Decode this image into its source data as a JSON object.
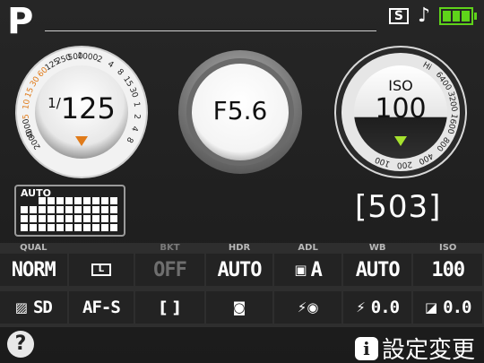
{
  "header": {
    "mode": "P",
    "sound_badge": "S",
    "note_icon": "♪"
  },
  "dials": {
    "shutter": {
      "value": "1/125",
      "top_value": "125",
      "scale": [
        "2000",
        "4000",
        "5",
        "10",
        "15",
        "30",
        "60",
        "125",
        "250",
        "500",
        "1000",
        "2",
        "4",
        "8",
        "15",
        "30",
        "1",
        "2",
        "4",
        "8"
      ]
    },
    "aperture": {
      "value": "F5.6"
    },
    "iso": {
      "label": "ISO",
      "value": "100",
      "scale": [
        "Hi",
        "6400",
        "3200",
        "1600",
        "800",
        "400",
        "200",
        "100"
      ]
    }
  },
  "drive": {
    "auto_label": "AUTO"
  },
  "shots_remaining": "[503]",
  "info_row1": [
    {
      "header": "QUAL",
      "value": "NORM",
      "dim": false
    },
    {
      "header": "",
      "value": "L",
      "dim": false
    },
    {
      "header": "BKT",
      "value": "OFF",
      "dim": true
    },
    {
      "header": "HDR",
      "value": "AUTO",
      "dim": false
    },
    {
      "header": "ADL",
      "value": "A",
      "dim": false
    },
    {
      "header": "WB",
      "value": "AUTO",
      "dim": false
    },
    {
      "header": "ISO",
      "value": "100",
      "dim": false
    }
  ],
  "info_row2": [
    {
      "value": "SD",
      "icon": "picture-control-icon"
    },
    {
      "value": "AF-S",
      "icon": ""
    },
    {
      "value": "",
      "icon": "af-area-icon"
    },
    {
      "value": "",
      "icon": "metering-icon"
    },
    {
      "value": "",
      "icon": "flash-redeye-icon"
    },
    {
      "value": "0.0",
      "icon": "flash-comp-icon"
    },
    {
      "value": "0.0",
      "icon": "exposure-comp-icon"
    }
  ],
  "footer": {
    "help": "?",
    "info_badge": "i",
    "settings_label": "設定変更"
  },
  "colors": {
    "battery": "#5fd31a",
    "shutter_marker": "#e07b1a",
    "iso_marker": "#a6e22e",
    "highlight_orange": "#e07b1a"
  }
}
